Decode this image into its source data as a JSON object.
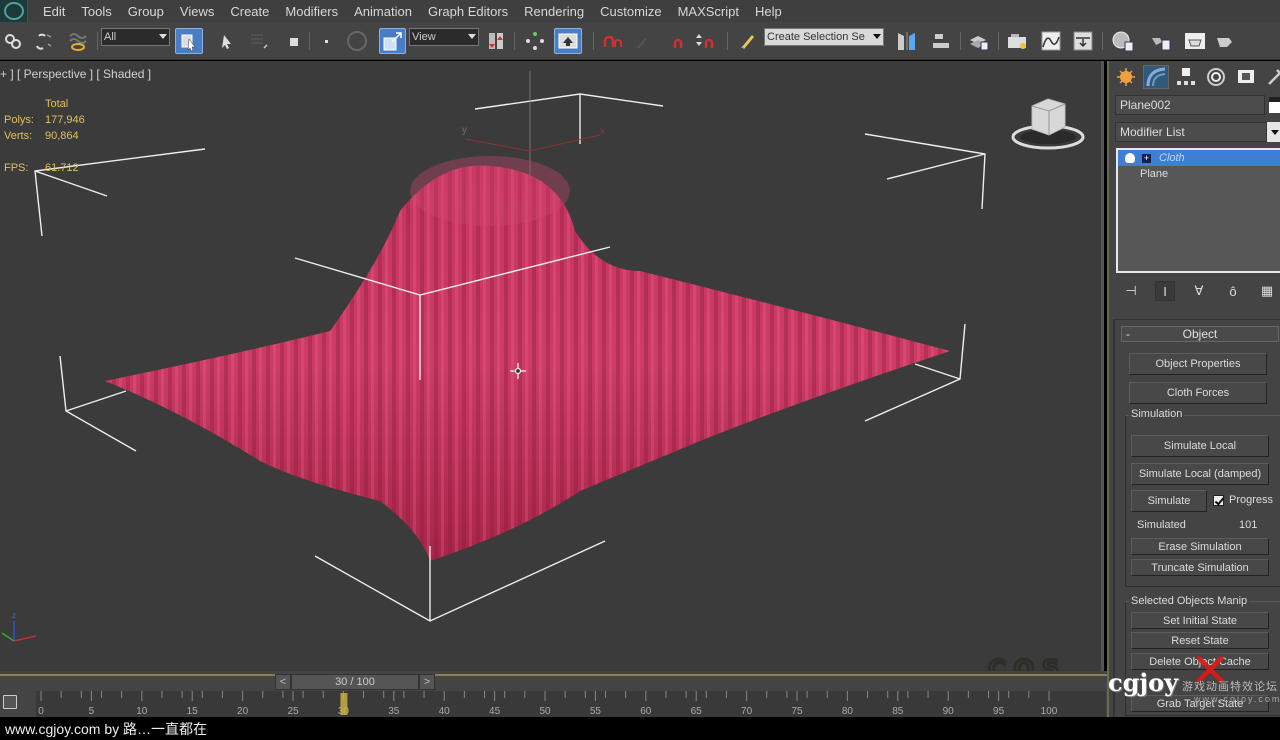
{
  "menubar": {
    "items": [
      "Edit",
      "Tools",
      "Group",
      "Views",
      "Create",
      "Modifiers",
      "Animation",
      "Graph Editors",
      "Rendering",
      "Customize",
      "MAXScript",
      "Help"
    ]
  },
  "toolbar": {
    "selection_filter": "All",
    "reference_coord": "View",
    "named_selection_placeholder": "Create Selection Se",
    "icons": [
      "link-icon",
      "unlink-icon",
      "bind-space-warp-icon",
      "select-object-icon",
      "select-cursor-icon",
      "select-region-icon",
      "window-crossing-icon",
      "move-icon",
      "rotate-icon",
      "scale-icon",
      "pivot-icon",
      "mirror-icon",
      "align-icon",
      "snap-2d-icon",
      "angle-snap-icon",
      "percent-snap-icon",
      "spinner-snap-icon",
      "edit-named-selection-icon",
      "mirror-tool-icon",
      "align-tool-icon",
      "layer-manager-icon",
      "scene-explorer-icon",
      "curve-editor-icon",
      "schematic-view-icon",
      "material-editor-icon",
      "render-setup-icon",
      "rendered-frame-icon",
      "render-production-icon"
    ]
  },
  "viewport": {
    "label": "+ ] [ Perspective ] [ Shaded ]",
    "stats": {
      "header": "Total",
      "polys_label": "Polys:",
      "polys": "177,946",
      "verts_label": "Verts:",
      "verts": "90,864",
      "fps_label": "FPS:",
      "fps": "61.712"
    },
    "cloth_color": "#c8365e",
    "background_color": "#3b3b3b"
  },
  "command_panel": {
    "tabs": [
      "create-tab",
      "modify-tab",
      "hierarchy-tab",
      "motion-tab",
      "display-tab",
      "utilities-tab"
    ],
    "object_name": "Plane002",
    "modifier_list": "Modifier List",
    "stack": [
      {
        "label": "Cloth",
        "selected": true
      },
      {
        "label": "Plane",
        "selected": false
      }
    ],
    "rollout": {
      "title": "Object",
      "collapse_symbol": "-",
      "object_properties": "Object Properties",
      "cloth_forces": "Cloth Forces",
      "simulation_group": "Simulation",
      "simulate_local": "Simulate Local",
      "simulate_local_damped": "Simulate Local (damped)",
      "simulate": "Simulate",
      "progress_label": "Progress",
      "progress_checked": true,
      "simulated_label": "Simulated",
      "simulated_value": "101",
      "erase_simulation": "Erase Simulation",
      "truncate_simulation": "Truncate Simulation",
      "selected_group": "Selected Objects Manip",
      "set_initial_state": "Set Initial State",
      "reset_state": "Reset State",
      "delete_cache": "Delete Object Cache",
      "grab_target_state": "Grab Target State"
    }
  },
  "timeline": {
    "prev": "<",
    "next": ">",
    "current_frame": 30,
    "total_frames": 100,
    "display": "30 / 100",
    "tick_labels": [
      "0",
      "5",
      "10",
      "15",
      "20",
      "25",
      "30",
      "35",
      "40",
      "45",
      "50",
      "55",
      "60",
      "65",
      "70",
      "75",
      "80",
      "85",
      "90",
      "95",
      "100"
    ]
  },
  "watermark": {
    "brand": "cgjoy",
    "subtitle": "游戏动画特效论坛",
    "url": "www.cgjoy.com"
  },
  "status": {
    "text": "www.cgjoy.com by 路…一直都在"
  }
}
